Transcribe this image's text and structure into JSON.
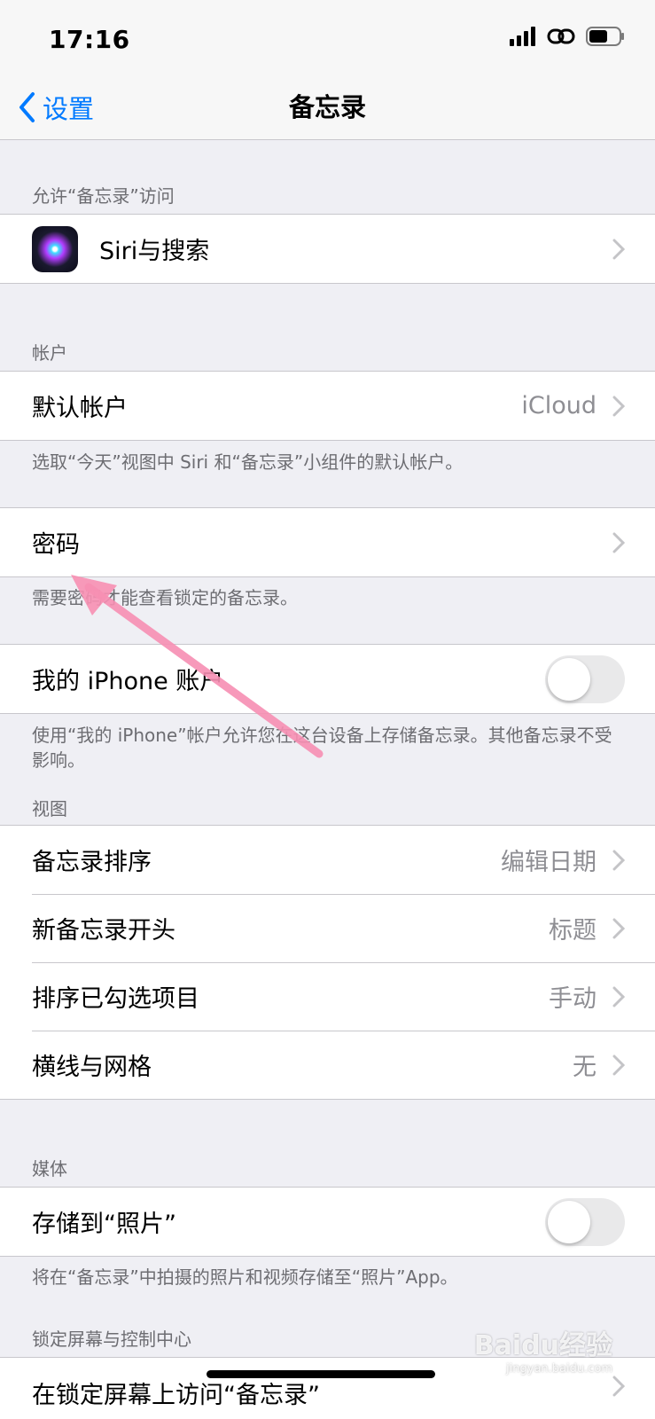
{
  "status": {
    "time": "17:16"
  },
  "nav": {
    "back_label": "设置",
    "title": "备忘录"
  },
  "sections": {
    "allow_access": {
      "header": "允许“备忘录”访问",
      "siri_row": {
        "label": "Siri与搜索"
      }
    },
    "accounts": {
      "header": "帐户",
      "default_account": {
        "label": "默认帐户",
        "value": "iCloud"
      },
      "footer": "选取“今天”视图中 Siri 和“备忘录”小组件的默认帐户。"
    },
    "password": {
      "row": {
        "label": "密码"
      },
      "footer": "需要密码才能查看锁定的备忘录。"
    },
    "on_my_iphone": {
      "row": {
        "label": "我的 iPhone 账户",
        "toggle_on": false
      },
      "footer": "使用“我的 iPhone”帐户允许您在这台设备上存储备忘录。其他备忘录不受影响。"
    },
    "view": {
      "header": "视图",
      "rows": [
        {
          "label": "备忘录排序",
          "value": "编辑日期"
        },
        {
          "label": "新备忘录开头",
          "value": "标题"
        },
        {
          "label": "排序已勾选项目",
          "value": "手动"
        },
        {
          "label": "横线与网格",
          "value": "无"
        }
      ]
    },
    "media": {
      "header": "媒体",
      "row": {
        "label": "存储到“照片”",
        "toggle_on": false
      },
      "footer": "将在“备忘录”中拍摄的照片和视频存储至“照片”App。"
    },
    "lock_screen": {
      "header": "锁定屏幕与控制中心",
      "row": {
        "label": "在锁定屏幕上访问“备忘录”"
      }
    }
  },
  "watermark": {
    "text": "Baidu经验",
    "sub": "jingyan.baidu.com"
  },
  "colors": {
    "accent": "#007aff",
    "background": "#efeff4",
    "annotation_arrow": "#f78fb3"
  }
}
